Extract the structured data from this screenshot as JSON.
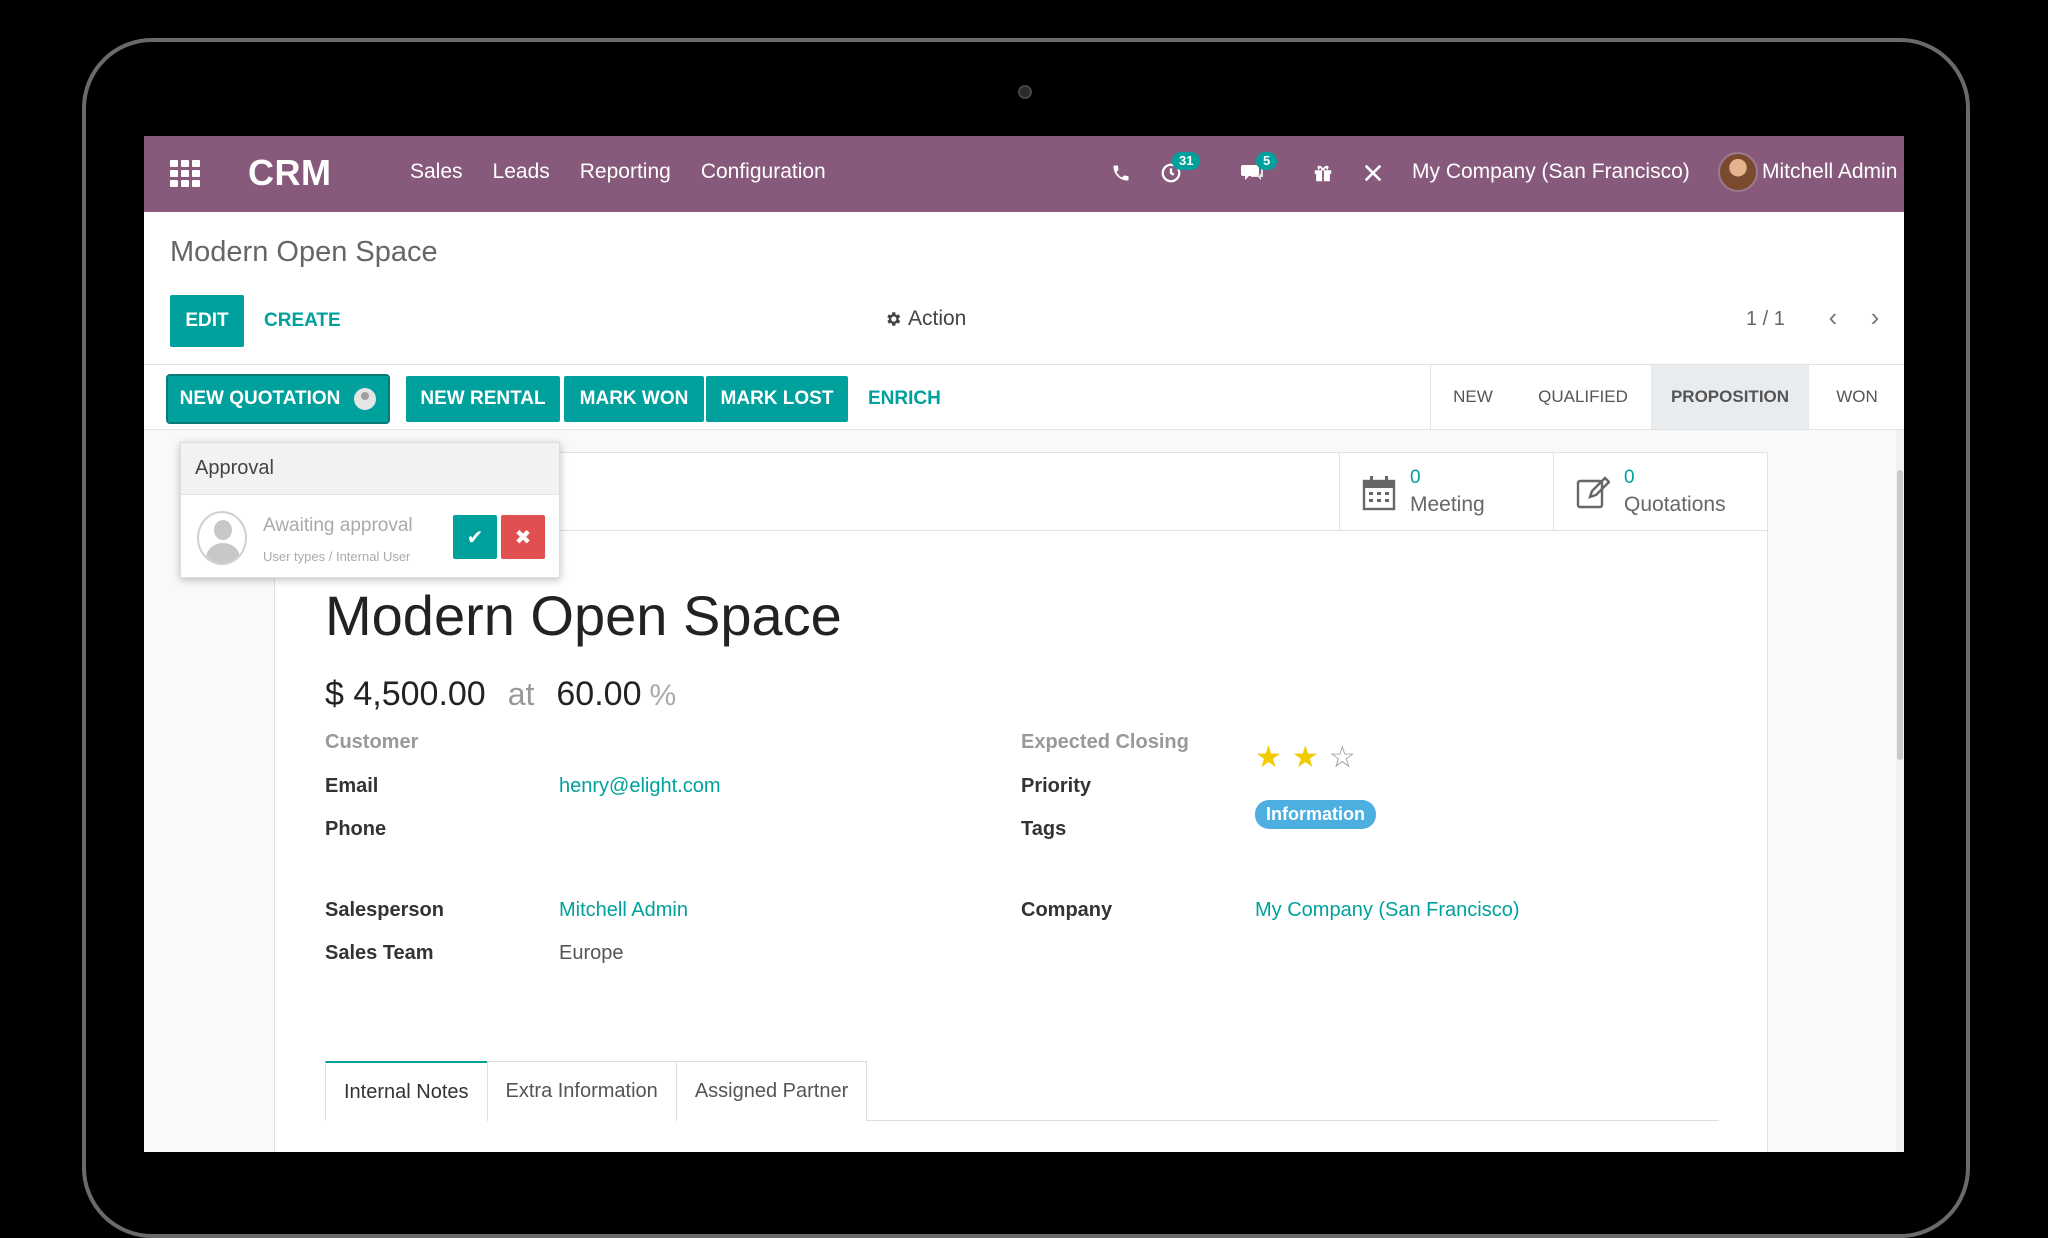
{
  "navbar": {
    "brand": "CRM",
    "menu": [
      "Sales",
      "Leads",
      "Reporting",
      "Configuration"
    ],
    "activity_count": "31",
    "message_count": "5",
    "company": "My Company (San Francisco)",
    "user": "Mitchell Admin",
    "bg_color": "#875a7b"
  },
  "control_panel": {
    "breadcrumb": "Modern Open Space",
    "edit_label": "EDIT",
    "create_label": "CREATE",
    "action_label": "Action",
    "pager": "1 / 1"
  },
  "statusbar": {
    "buttons": [
      "NEW QUOTATION",
      "NEW RENTAL",
      "MARK WON",
      "MARK LOST"
    ],
    "enrich_label": "ENRICH",
    "stages": [
      "NEW",
      "QUALIFIED",
      "PROPOSITION",
      "WON"
    ],
    "active_stage": "PROPOSITION",
    "accent_color": "#00a09d"
  },
  "approval": {
    "title": "Approval",
    "status": "Awaiting approval",
    "group": "User types / Internal User"
  },
  "smart_buttons": {
    "meeting": {
      "count": "0",
      "label": "Meeting"
    },
    "quotations": {
      "count": "0",
      "label": "Quotations"
    }
  },
  "form": {
    "title": "Modern Open Space",
    "revenue": "$ 4,500.00",
    "at_label": "at",
    "probability": "60.00",
    "percent_sign": "%",
    "customer_label": "Customer",
    "email_label": "Email",
    "email": "henry@elight.com",
    "phone_label": "Phone",
    "salesperson_label": "Salesperson",
    "salesperson": "Mitchell Admin",
    "sales_team_label": "Sales Team",
    "sales_team": "Europe",
    "expected_closing_label": "Expected Closing",
    "priority_label": "Priority",
    "priority_stars": 2,
    "priority_max": 3,
    "tags_label": "Tags",
    "tag": "Information",
    "company_label": "Company",
    "company": "My Company (San Francisco)"
  },
  "tabs": [
    "Internal Notes",
    "Extra Information",
    "Assigned Partner"
  ],
  "active_tab": "Internal Notes"
}
